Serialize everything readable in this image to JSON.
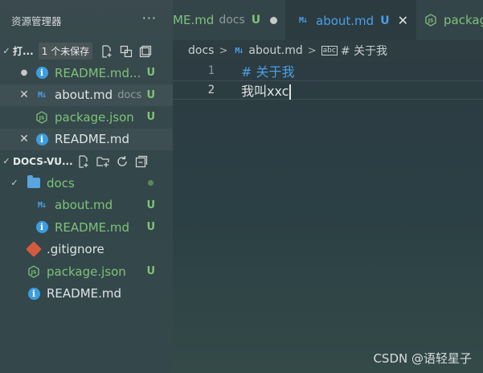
{
  "sidebar": {
    "title": "资源管理器",
    "more": "···",
    "open_editors": {
      "label": "打...",
      "unsaved_badge": "1 个未保存",
      "items": [
        {
          "name": "README.md...",
          "status": "U"
        },
        {
          "name": "about.md",
          "dir": "docs",
          "status": "U"
        },
        {
          "name": "package.json",
          "status": "U"
        },
        {
          "name": "README.md",
          "status": ""
        }
      ]
    },
    "workspace": {
      "label": "DOCS-VU...",
      "items": [
        {
          "name": "docs",
          "status": "●"
        },
        {
          "name": "about.md",
          "status": "U"
        },
        {
          "name": "README.md",
          "status": "U"
        },
        {
          "name": ".gitignore",
          "status": ""
        },
        {
          "name": "package.json",
          "status": "U"
        },
        {
          "name": "README.md",
          "status": ""
        }
      ]
    }
  },
  "tabs": [
    {
      "label": "ME.md",
      "dir": "docs",
      "status": "U"
    },
    {
      "label": "about.md",
      "status": "U"
    },
    {
      "label": "packag"
    }
  ],
  "breadcrumb": {
    "parts": [
      "docs",
      "about.md",
      "# 关于我"
    ],
    "abc": "abc"
  },
  "editor": {
    "lines": [
      {
        "num": "1",
        "text": "# 关于我"
      },
      {
        "num": "2",
        "text": "我叫xxc"
      }
    ]
  },
  "watermark": "CSDN @语轻星子",
  "colors": {
    "accent_blue": "#3c9ee0",
    "git_untracked_green": "#7fc27a",
    "heading_blue": "#4a9fe3"
  }
}
